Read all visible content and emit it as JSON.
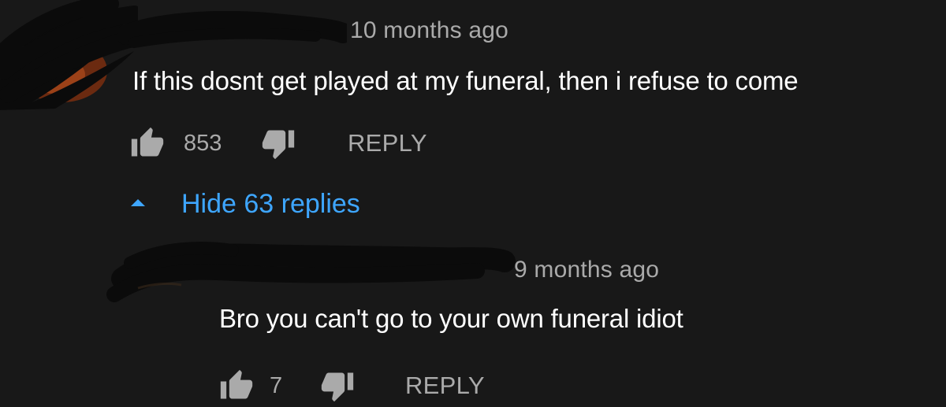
{
  "colors": {
    "background": "#181818",
    "primary_text": "#ffffff",
    "secondary_text": "#aaaaaa",
    "link_blue": "#3ea6ff",
    "redaction": "#0b0b0b"
  },
  "comment": {
    "timestamp": "10 months ago",
    "text": "If this dosnt get played at my funeral, then i refuse to come",
    "like_count": "853",
    "like_icon": "thumbs-up-icon",
    "dislike_icon": "thumbs-down-icon",
    "reply_label": "REPLY",
    "replies_toggle_icon": "caret-up-icon",
    "replies_toggle_label": "Hide 63 replies"
  },
  "reply": {
    "timestamp": "9 months ago",
    "text": "Bro you can't go to your own funeral idiot",
    "like_count": "7",
    "like_icon": "thumbs-up-icon",
    "dislike_icon": "thumbs-down-icon",
    "reply_label": "REPLY"
  }
}
